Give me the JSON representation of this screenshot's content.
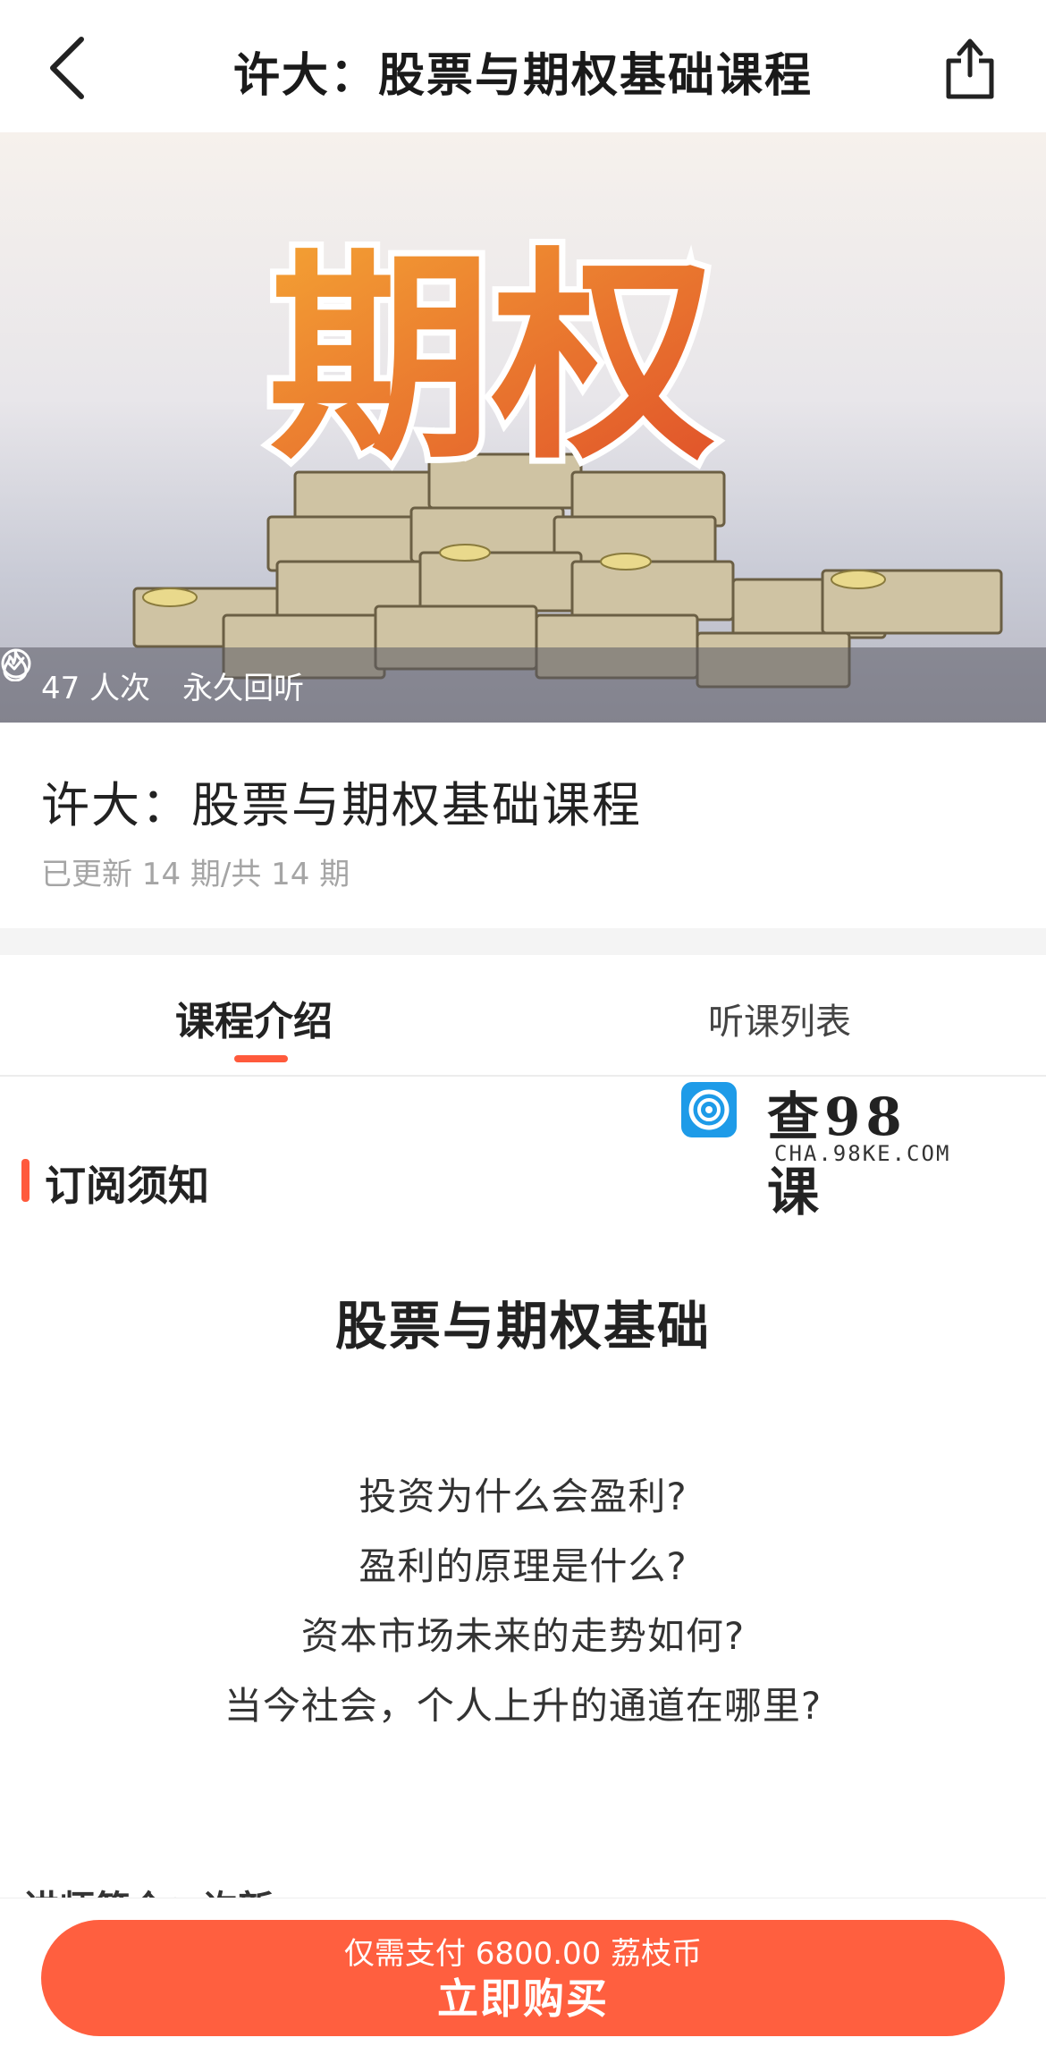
{
  "header": {
    "title": "许大：股票与期权基础课程",
    "back_icon": "chevron-left-icon",
    "share_icon": "share-icon"
  },
  "banner": {
    "art_text": "期权",
    "stats": {
      "views": "47 人次",
      "replay": "永久回听"
    }
  },
  "course": {
    "title": "许大：股票与期权基础课程",
    "update": "已更新 14 期/共 14 期"
  },
  "tabs": [
    {
      "label": "课程介绍",
      "active": true
    },
    {
      "label": "听课列表",
      "active": false
    }
  ],
  "watermark": {
    "text": "查98课",
    "url": "CHA.98KE.COM"
  },
  "section": {
    "title": "订阅须知",
    "heading": "股票与期权基础",
    "questions": [
      "投资为什么会盈利?",
      "盈利的原理是什么?",
      "资本市场未来的走势如何?",
      "当今社会，个人上升的通道在哪里?"
    ],
    "cut_text": "讲师简介：许新"
  },
  "footer": {
    "price_line": "仅需支付 6800.00 荔枝币",
    "buy_label": "立即购买"
  },
  "colors": {
    "accent": "#ff5a3c",
    "button": "#ff5f3f"
  }
}
